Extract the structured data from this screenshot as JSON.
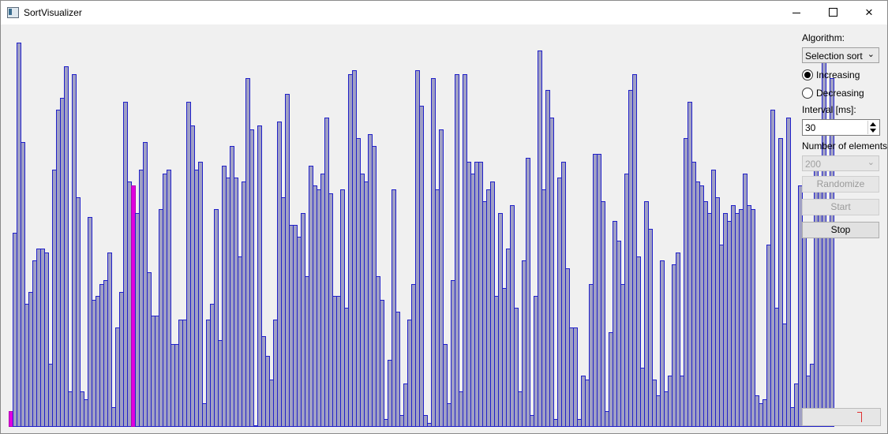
{
  "window": {
    "title": "SortVisualizer",
    "icon": "app-window-icon",
    "controls": {
      "minimize": "minimize-icon",
      "maximize": "maximize-icon",
      "close": "×"
    }
  },
  "colors": {
    "bar_fill": "#a0a0c4",
    "bar_border": "#2020c8",
    "highlight": "#e000e0",
    "background": "#f0f0f0"
  },
  "visualization": {
    "max_value": 100,
    "highlighted_indices": [
      0,
      31
    ],
    "values": [
      4,
      49,
      97,
      72,
      31,
      34,
      42,
      45,
      45,
      44,
      16,
      65,
      80,
      83,
      91,
      9,
      89,
      58,
      9,
      7,
      53,
      32,
      33,
      36,
      37,
      44,
      5,
      25,
      34,
      82,
      62,
      61,
      54,
      65,
      72,
      39,
      28,
      28,
      55,
      64,
      65,
      21,
      21,
      27,
      27,
      82,
      76,
      65,
      67,
      6,
      27,
      31,
      55,
      22,
      66,
      63,
      71,
      63,
      43,
      62,
      88,
      75,
      0,
      76,
      23,
      18,
      12,
      27,
      77,
      58,
      84,
      51,
      51,
      48,
      54,
      38,
      66,
      61,
      60,
      64,
      78,
      59,
      33,
      33,
      60,
      30,
      89,
      90,
      73,
      64,
      62,
      74,
      71,
      38,
      32,
      2,
      17,
      60,
      29,
      3,
      11,
      27,
      36,
      90,
      81,
      3,
      1,
      88,
      60,
      75,
      21,
      6,
      37,
      89,
      9,
      89,
      67,
      64,
      67,
      67,
      57,
      60,
      62,
      33,
      54,
      35,
      45,
      56,
      30,
      9,
      42,
      68,
      3,
      33,
      95,
      60,
      85,
      78,
      2,
      63,
      67,
      40,
      25,
      25,
      2,
      13,
      12,
      36,
      69,
      69,
      57,
      4,
      24,
      52,
      47,
      36,
      64,
      85,
      89,
      43,
      15,
      57,
      50,
      12,
      8,
      42,
      9,
      13,
      41,
      44,
      13,
      73,
      82,
      67,
      62,
      61,
      57,
      54,
      65,
      58,
      46,
      54,
      52,
      56,
      54,
      55,
      64,
      56,
      55,
      8,
      6,
      7,
      46,
      80,
      30,
      73,
      26,
      78,
      5,
      11,
      61,
      49,
      13,
      16,
      65,
      61,
      93,
      51,
      88
    ]
  },
  "controls": {
    "algorithm_label": "Algorithm:",
    "algorithm_value": "Selection sort",
    "increasing_label": "Increasing",
    "decreasing_label": "Decreasing",
    "order_selected": "increasing",
    "interval_label": "Interval [ms]:",
    "interval_value": "30",
    "elements_label": "Number of elements:",
    "elements_value": "200",
    "randomize_label": "Randomize",
    "start_label": "Start",
    "stop_label": "Stop"
  },
  "progress": {
    "fraction": 0
  }
}
